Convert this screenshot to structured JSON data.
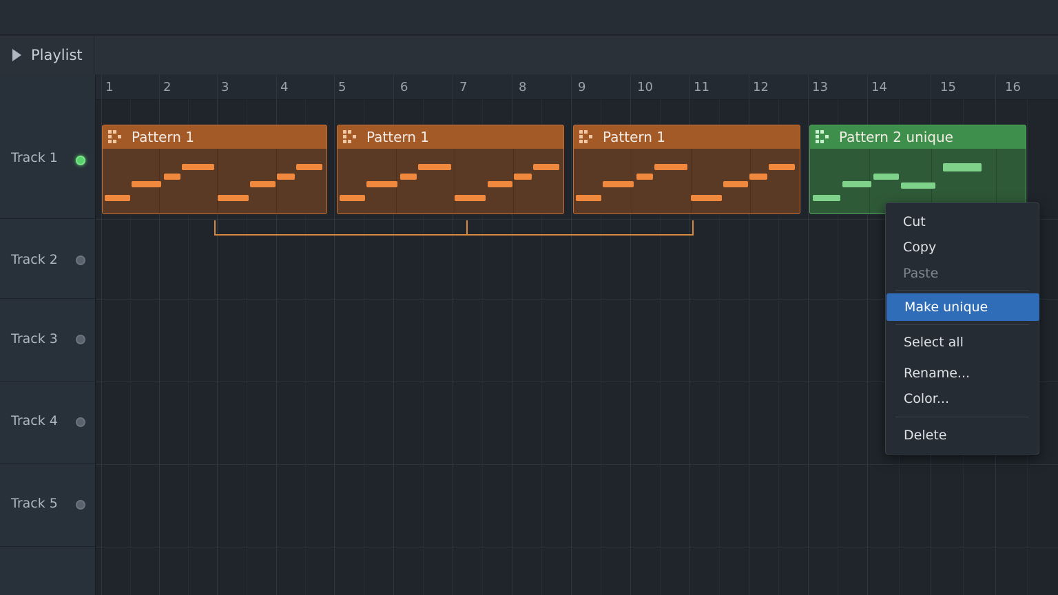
{
  "panel": {
    "title": "Playlist"
  },
  "tracks": [
    {
      "name": "Track 1",
      "active": true
    },
    {
      "name": "Track 2",
      "active": false
    },
    {
      "name": "Track 3",
      "active": false
    },
    {
      "name": "Track 4",
      "active": false
    },
    {
      "name": "Track 5",
      "active": false
    }
  ],
  "ruler": {
    "bars": [
      "1",
      "2",
      "3",
      "4",
      "5",
      "6",
      "7",
      "8",
      "9",
      "10",
      "11",
      "12",
      "13",
      "14",
      "15",
      "16"
    ]
  },
  "clips": [
    {
      "name": "Pattern 1",
      "color": "#a45a27"
    },
    {
      "name": "Pattern 1",
      "color": "#a45a27"
    },
    {
      "name": "Pattern 1",
      "color": "#a45a27"
    },
    {
      "name": "Pattern 2 unique",
      "color": "#3f8f4c"
    }
  ],
  "context_menu": {
    "items": [
      {
        "label": "Cut",
        "state": "enabled"
      },
      {
        "label": "Copy",
        "state": "enabled"
      },
      {
        "label": "Paste",
        "state": "disabled"
      },
      {
        "label": "Make unique",
        "state": "selected"
      },
      {
        "label": "Select all",
        "state": "enabled"
      },
      {
        "label": "Rename...",
        "state": "enabled"
      },
      {
        "label": "Color...",
        "state": "enabled"
      },
      {
        "label": "Delete",
        "state": "enabled"
      }
    ]
  },
  "colors": {
    "accent_orange": "#f0883e",
    "accent_green": "#58d36b",
    "selection_blue": "#2f6db8"
  }
}
